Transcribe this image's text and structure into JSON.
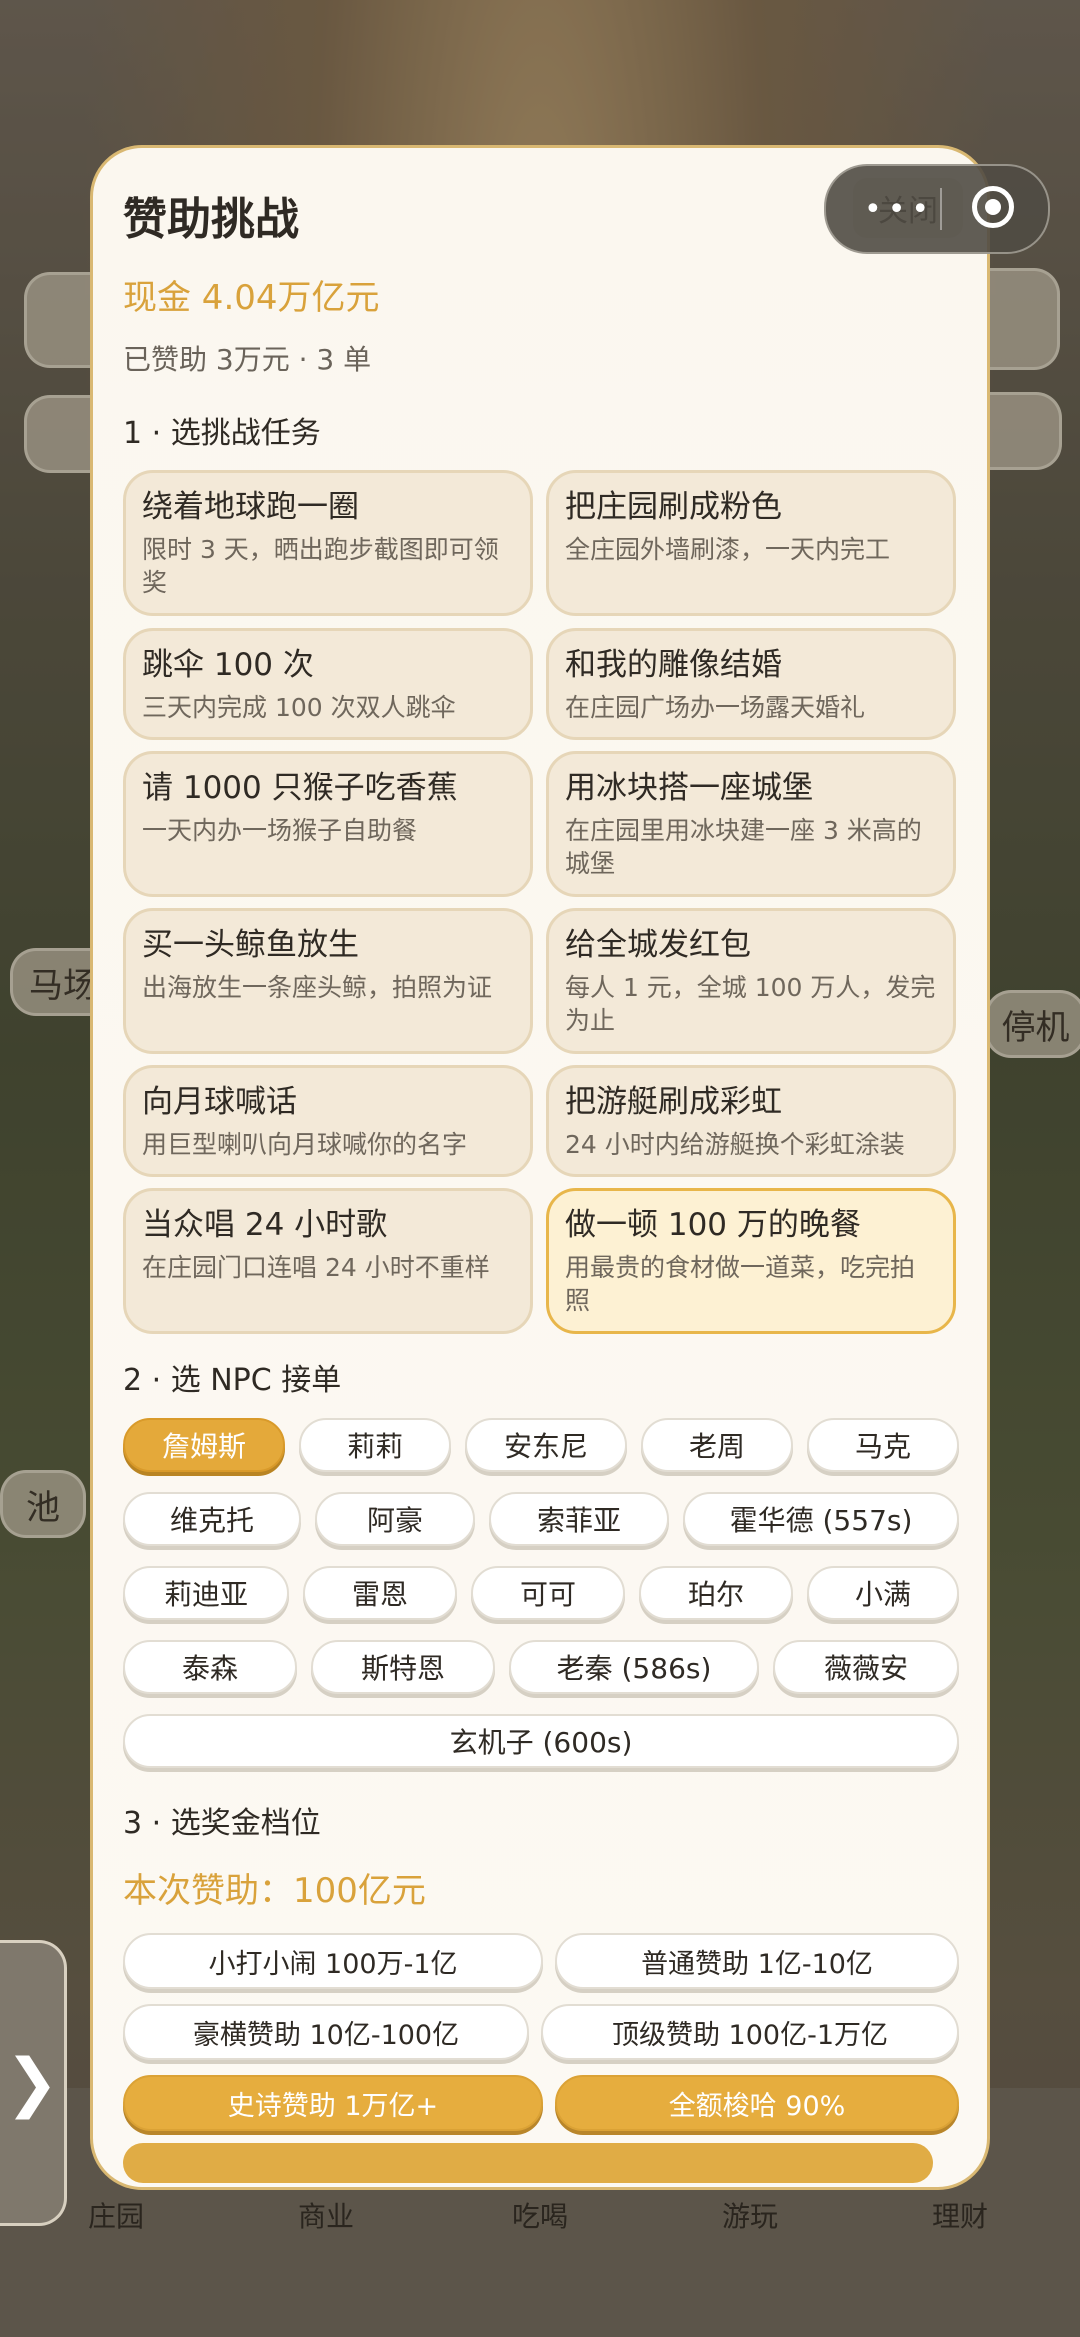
{
  "title": "赞助挑战",
  "close_label": "关闭",
  "capsule_menu": "•••",
  "cash": "现金 4.04万亿元",
  "sponsored": "已赞助 3万元 · 3 单",
  "sections": {
    "tasks": "1 · 选挑战任务",
    "npc": "2 · 选 NPC 接单",
    "bonus": "3 · 选奖金档位"
  },
  "tasks": [
    {
      "title": "绕着地球跑一圈",
      "desc": "限时 3 天，晒出跑步截图即可领奖"
    },
    {
      "title": "把庄园刷成粉色",
      "desc": "全庄园外墙刷漆，一天内完工"
    },
    {
      "title": "跳伞 100 次",
      "desc": "三天内完成 100 次双人跳伞"
    },
    {
      "title": "和我的雕像结婚",
      "desc": "在庄园广场办一场露天婚礼"
    },
    {
      "title": "请 1000 只猴子吃香蕉",
      "desc": "一天内办一场猴子自助餐"
    },
    {
      "title": "用冰块搭一座城堡",
      "desc": "在庄园里用冰块建一座 3 米高的城堡"
    },
    {
      "title": "买一头鲸鱼放生",
      "desc": "出海放生一条座头鲸，拍照为证"
    },
    {
      "title": "给全城发红包",
      "desc": "每人 1 元，全城 100 万人，发完为止"
    },
    {
      "title": "向月球喊话",
      "desc": "用巨型喇叭向月球喊你的名字"
    },
    {
      "title": "把游艇刷成彩虹",
      "desc": "24 小时内给游艇换个彩虹涂装"
    },
    {
      "title": "当众唱 24 小时歌",
      "desc": "在庄园门口连唱 24 小时不重样"
    },
    {
      "title": "做一顿 100 万的晚餐",
      "desc": "用最贵的食材做一道菜，吃完拍照"
    }
  ],
  "npcs": [
    "詹姆斯",
    "莉莉",
    "安东尼",
    "老周",
    "马克",
    "维克托",
    "阿豪",
    "索菲亚",
    "霍华德 (557s)",
    "莉迪亚",
    "雷恩",
    "可可",
    "珀尔",
    "小满",
    "泰森",
    "斯特恩",
    "老秦 (586s)",
    "薇薇安",
    "玄机子 (600s)"
  ],
  "amount": "本次赞助：100亿元",
  "tiers": [
    "小打小闹 100万-1亿",
    "普通赞助 1亿-10亿",
    "豪横赞助 10亿-100亿",
    "顶级赞助 100亿-1万亿",
    "史诗赞助 1万亿+",
    "全额梭哈 90%"
  ],
  "background": {
    "labels": [
      "马场",
      "停机",
      "池"
    ],
    "nav": [
      "庄园",
      "商业",
      "吃喝",
      "游玩",
      "理财"
    ]
  },
  "colors": {
    "accent": "#e4a93a",
    "gold_text": "#d9a23b",
    "border": "#d9b872"
  }
}
